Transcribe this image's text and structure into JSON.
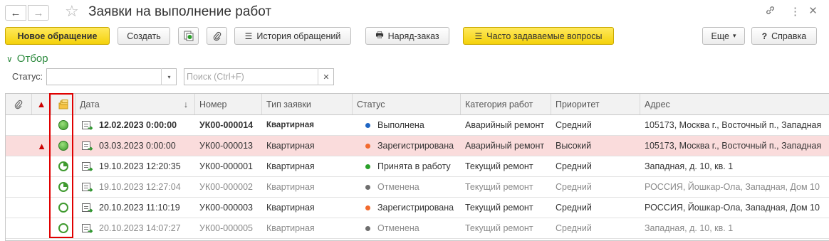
{
  "window": {
    "title": "Заявки на выполнение работ",
    "nav_back": "←",
    "nav_forward": "→",
    "favorite_icon": "☆",
    "link_icon": "🔗",
    "more_icon": "⋮",
    "close_icon": "×"
  },
  "toolbar": {
    "new_request": "Новое обращение",
    "create": "Создать",
    "history": "История обращений",
    "work_order": "Наряд-заказ",
    "faq": "Часто задаваемые вопросы",
    "more": "Еще",
    "more_arrow": "▾",
    "help_icon": "?",
    "help": "Справка"
  },
  "filter": {
    "toggle": "Отбор",
    "toggle_icon": "∨",
    "status_label": "Статус:",
    "status_value": "",
    "status_dropdown": "▾",
    "search_placeholder": "Поиск (Ctrl+F)",
    "search_clear": "✕"
  },
  "table": {
    "columns": {
      "attach": "📎",
      "warning": "▲",
      "state": "",
      "date": "Дата",
      "sort": "↓",
      "number": "Номер",
      "type": "Тип заявки",
      "status": "Статус",
      "category": "Категория работ",
      "priority": "Приоритет",
      "address": "Адрес"
    },
    "rows": [
      {
        "warn": "",
        "date": "12.02.2023 0:00:00",
        "number": "УК00-000014",
        "type": "Квартирная",
        "status": "Выполнена",
        "category": "Аварийный ремонт",
        "priority": "Средний",
        "address": "105173, Москва г., Восточный п., Западная"
      },
      {
        "warn": "▲",
        "date": "03.03.2023 0:00:00",
        "number": "УК00-000013",
        "type": "Квартирная",
        "status": "Зарегистрирована",
        "category": "Аварийный ремонт",
        "priority": "Высокий",
        "address": "105173, Москва г., Восточный п., Западная"
      },
      {
        "warn": "",
        "date": "19.10.2023 12:20:35",
        "number": "УК00-000001",
        "type": "Квартирная",
        "status": "Принята в работу",
        "category": "Текущий ремонт",
        "priority": "Средний",
        "address": "Западная, д. 10, кв. 1"
      },
      {
        "warn": "",
        "date": "19.10.2023 12:27:04",
        "number": "УК00-000002",
        "type": "Квартирная",
        "status": "Отменена",
        "category": "Текущий ремонт",
        "priority": "Средний",
        "address": "РОССИЯ, Йошкар-Ола, Западная, Дом 10"
      },
      {
        "warn": "",
        "date": "20.10.2023 11:10:19",
        "number": "УК00-000003",
        "type": "Квартирная",
        "status": "Зарегистрирована",
        "category": "Текущий ремонт",
        "priority": "Средний",
        "address": "РОССИЯ, Йошкар-Ола, Западная, Дом 10"
      },
      {
        "warn": "",
        "date": "20.10.2023 14:07:27",
        "number": "УК00-000005",
        "type": "Квартирная",
        "status": "Отменена",
        "category": "Текущий ремонт",
        "priority": "Средний",
        "address": "Западная, д. 10, кв. 1"
      }
    ]
  },
  "colors": {
    "status_done": "#1f66c4",
    "status_registered": "#f26a2e",
    "status_in_work": "#2aa02a",
    "status_cancelled": "#6e6e6e",
    "highlight_row": "#fadcdc",
    "accent_button": "#f4d20b",
    "selection_outline": "#e00000"
  }
}
